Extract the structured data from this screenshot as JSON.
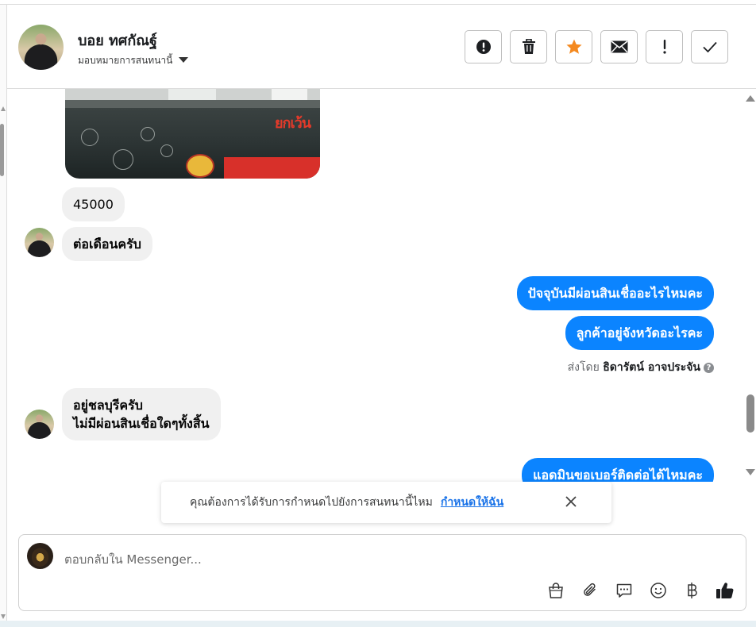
{
  "header": {
    "contact_name": "บอย ทศกัณฐ์",
    "assign_label": "มอบหมายการสนทนานี้",
    "toolbar": [
      {
        "name": "spam-button",
        "icon": "alert-circle-icon"
      },
      {
        "name": "delete-button",
        "icon": "trash-icon"
      },
      {
        "name": "star-button",
        "icon": "star-icon"
      },
      {
        "name": "mark-unread-button",
        "icon": "envelope-icon"
      },
      {
        "name": "follow-up-button",
        "icon": "exclamation-icon"
      },
      {
        "name": "done-button",
        "icon": "check-icon"
      }
    ],
    "accent_star": "#f4891f"
  },
  "messages": {
    "m1": "45000",
    "m2": "ต่อเดือนครับ",
    "m3": "ปัจจุบันมีผ่อนสินเชื่ออะไรไหมคะ",
    "m4": "ลูกค้าอยู่จังหวัดอะไรคะ",
    "sent_by_prefix": "ส่งโดย",
    "sent_by_name": "ธิดารัตน์ อาจประจัน",
    "m5_line1": "อยู่ชลบุรีครับ",
    "m5_line2": "ไม่มีผ่อนสินเชื่อใดๆทั้งสิ้น",
    "m6": "แอดมินขอเบอร์ติดต่อได้ไหมคะ",
    "photo_text": "ยกเว้น"
  },
  "toast": {
    "text": "คุณต้องการได้รับการกำหนดไปยังการสนทนานี้ไหม",
    "link": "กำหนดให้ฉัน"
  },
  "composer": {
    "placeholder": "ตอบกลับใน Messenger...",
    "icons": [
      "shopping-bag-icon",
      "paperclip-icon",
      "saved-reply-icon",
      "emoji-icon",
      "baht-icon",
      "thumbs-up-icon"
    ]
  },
  "colors": {
    "outgoing_bubble": "#0b84ff",
    "incoming_bubble": "#f0f0f0",
    "link": "#1a73e8"
  }
}
